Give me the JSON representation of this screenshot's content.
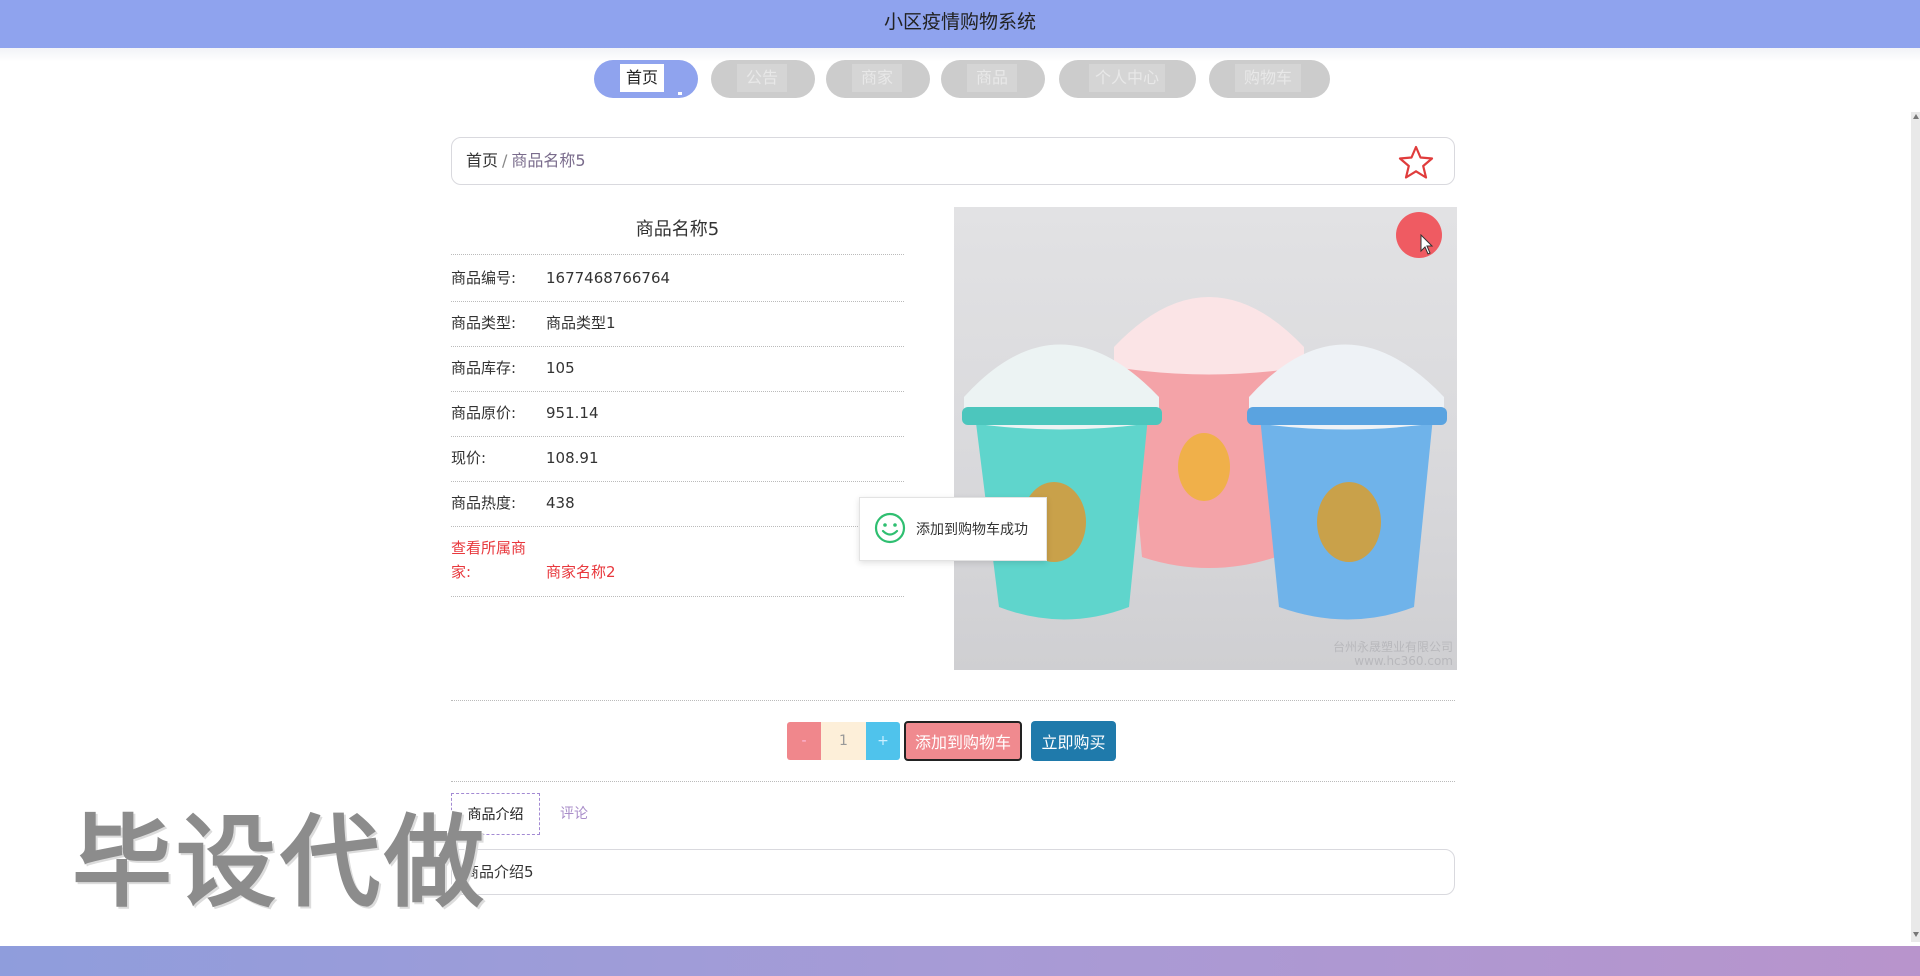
{
  "app": {
    "title": "小区疫情购物系统"
  },
  "nav": {
    "items": [
      {
        "label": "首页",
        "active": true
      },
      {
        "label": "公告",
        "active": false
      },
      {
        "label": "商家",
        "active": false
      },
      {
        "label": "商品",
        "active": false
      },
      {
        "label": "个人中心",
        "active": false
      },
      {
        "label": "购物车",
        "active": false
      }
    ]
  },
  "breadcrumb": {
    "home": "首页",
    "separator": "/",
    "current": "商品名称5",
    "favorite_icon": "star-outline-icon"
  },
  "product": {
    "name": "商品名称5",
    "fields": [
      {
        "label": "商品编号:",
        "value": "1677468766764"
      },
      {
        "label": "商品类型:",
        "value": "商品类型1"
      },
      {
        "label": "商品库存:",
        "value": "105"
      },
      {
        "label": "商品原价:",
        "value": "951.14"
      },
      {
        "label": "现价:",
        "value": "108.91"
      },
      {
        "label": "商品热度:",
        "value": "438"
      }
    ],
    "merchant_label_line1": "查看所属商",
    "merchant_label_line2": "家:",
    "merchant_name": "商家名称2",
    "image_watermark_line1": "台州永晟塑业有限公司",
    "image_watermark_line2": "www.hc360.com"
  },
  "toast": {
    "message": "添加到购物车成功",
    "icon": "smile-icon"
  },
  "purchase": {
    "minus_label": "-",
    "quantity": "1",
    "plus_label": "+",
    "add_to_cart_label": "添加到购物车",
    "buy_now_label": "立即购买"
  },
  "tabs": [
    {
      "label": "商品介绍",
      "active": true
    },
    {
      "label": "评论",
      "active": false
    }
  ],
  "intro": {
    "text": "商品介绍5"
  },
  "overlay": {
    "watermark": "毕设代做"
  },
  "colors": {
    "header": "#8fa3ee",
    "accent_red": "#e8383d",
    "buy_button": "#1f7aab",
    "cart_button": "#f08a8f"
  }
}
